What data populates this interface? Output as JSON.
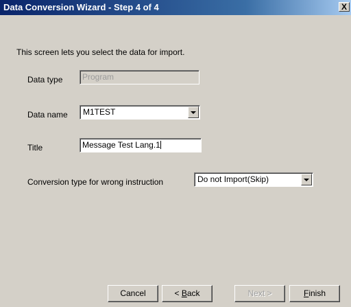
{
  "window": {
    "title": "Data Conversion Wizard - Step 4 of 4",
    "close_glyph": "X"
  },
  "intro": "This screen lets you select the data for import.",
  "form": {
    "data_type": {
      "label": "Data type",
      "value": "Program"
    },
    "data_name": {
      "label": "Data name",
      "value": "M1TEST"
    },
    "title": {
      "label": "Title",
      "value": "Message Test Lang.1"
    },
    "conversion_type": {
      "label": "Conversion type for wrong instruction",
      "value": "Do not Import(Skip)"
    }
  },
  "buttons": {
    "cancel": "Cancel",
    "back_prefix": "< ",
    "back_key": "B",
    "back_rest": "ack",
    "next": "Next >",
    "finish_key": "F",
    "finish_rest": "inish"
  }
}
